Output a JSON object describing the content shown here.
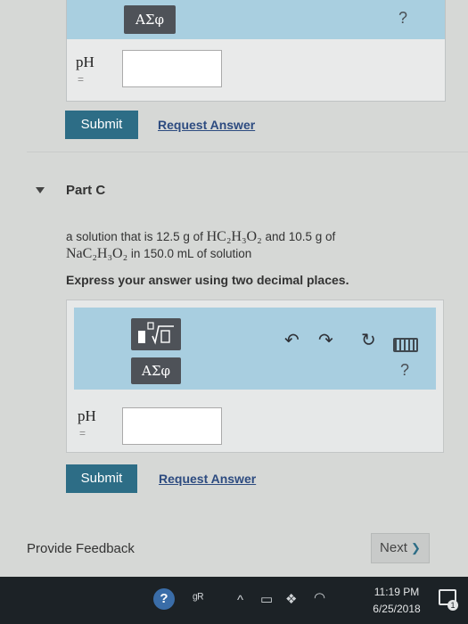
{
  "prev_part": {
    "symbol_button": "ΑΣφ",
    "help": "?",
    "ph_label": "pH",
    "ph_eq": "=",
    "ph_value": "",
    "submit_label": "Submit",
    "request_label": "Request Answer"
  },
  "part_c": {
    "title": "Part C",
    "question_line1_a": "a solution that is 12.5 g of ",
    "question_line1_formula": "HC₂H₃O₂",
    "question_line1_b": " and 10.5 g of",
    "question_line2_formula": "NaC₂H₃O₂",
    "question_line2_b": " in 150.0 mL of solution",
    "instruction": "Express your answer using two decimal places.",
    "symbol_button": "ΑΣφ",
    "help": "?",
    "ph_label": "pH",
    "ph_eq": "=",
    "ph_value": "",
    "submit_label": "Submit",
    "request_label": "Request Answer"
  },
  "footer": {
    "feedback_label": "Provide Feedback",
    "next_label": "Next",
    "next_chevron": "❯"
  },
  "taskbar": {
    "help_glyph": "?",
    "time": "11:19 PM",
    "date": "6/25/2018",
    "notification_count": "1"
  },
  "icons": {
    "undo": "↶",
    "redo": "↷",
    "reset": "↻",
    "people": "ᵍᴿ",
    "chevron_up": "^",
    "battery": "▭",
    "dropbox": "❖",
    "wifi": "◠"
  }
}
